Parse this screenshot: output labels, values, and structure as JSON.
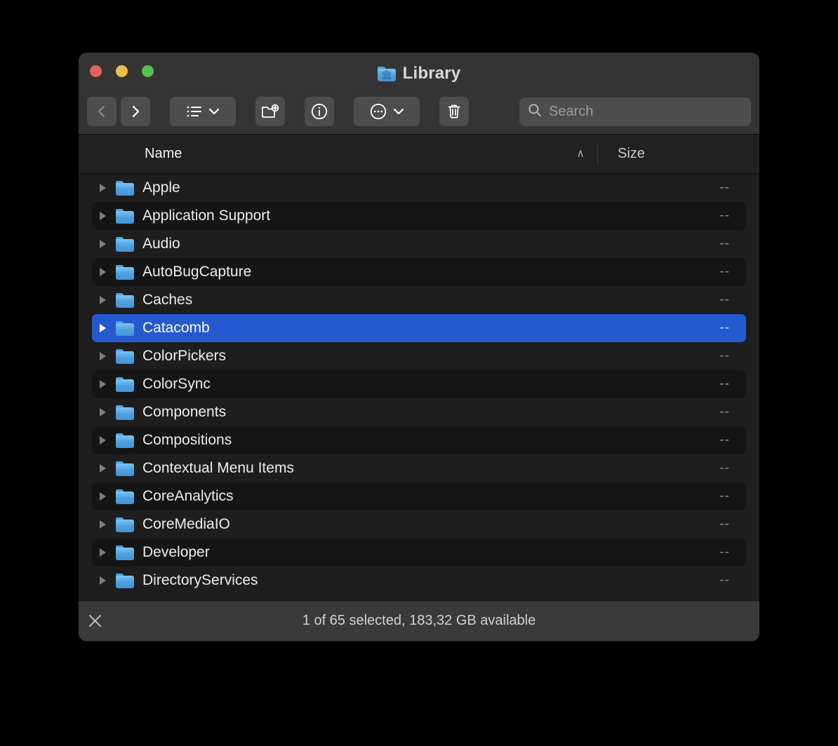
{
  "window": {
    "title": "Library",
    "title_icon": "library-folder-icon",
    "traffic_lights": [
      {
        "name": "close-button",
        "color": "#e2635b"
      },
      {
        "name": "minimize-button",
        "color": "#f0bc4f"
      },
      {
        "name": "maximize-button",
        "color": "#55c04f"
      }
    ]
  },
  "toolbar": {
    "back_icon": "chevron-left-icon",
    "forward_icon": "chevron-right-icon",
    "view_icon": "list-view-icon",
    "view_chevron_icon": "chevron-down-icon",
    "new_folder_icon": "new-folder-icon",
    "info_icon": "info-circle-icon",
    "actions_icon": "ellipsis-circle-icon",
    "actions_chevron_icon": "chevron-down-icon",
    "delete_icon": "trash-icon"
  },
  "search": {
    "icon": "search-icon",
    "placeholder": "Search",
    "value": ""
  },
  "columns": {
    "name": "Name",
    "sort_indicator": "∧",
    "size": "Size"
  },
  "files": [
    {
      "name": "Apple",
      "size": "--",
      "selected": false
    },
    {
      "name": "Application Support",
      "size": "--",
      "selected": false
    },
    {
      "name": "Audio",
      "size": "--",
      "selected": false
    },
    {
      "name": "AutoBugCapture",
      "size": "--",
      "selected": false
    },
    {
      "name": "Caches",
      "size": "--",
      "selected": false
    },
    {
      "name": "Catacomb",
      "size": "--",
      "selected": true
    },
    {
      "name": "ColorPickers",
      "size": "--",
      "selected": false
    },
    {
      "name": "ColorSync",
      "size": "--",
      "selected": false
    },
    {
      "name": "Components",
      "size": "--",
      "selected": false
    },
    {
      "name": "Compositions",
      "size": "--",
      "selected": false
    },
    {
      "name": "Contextual Menu Items",
      "size": "--",
      "selected": false
    },
    {
      "name": "CoreAnalytics",
      "size": "--",
      "selected": false
    },
    {
      "name": "CoreMediaIO",
      "size": "--",
      "selected": false
    },
    {
      "name": "Developer",
      "size": "--",
      "selected": false
    },
    {
      "name": "DirectoryServices",
      "size": "--",
      "selected": false
    }
  ],
  "status": {
    "icon": "pencil-slash-icon",
    "text": "1 of 65 selected, 183,32 GB available"
  },
  "colors": {
    "selection_blue": "#2559cf",
    "window_bg": "#1e1e1e",
    "titlebar_bg": "#343434",
    "statusbar_bg": "#3a3a3a",
    "folder_blue": "#4c9fdc"
  }
}
